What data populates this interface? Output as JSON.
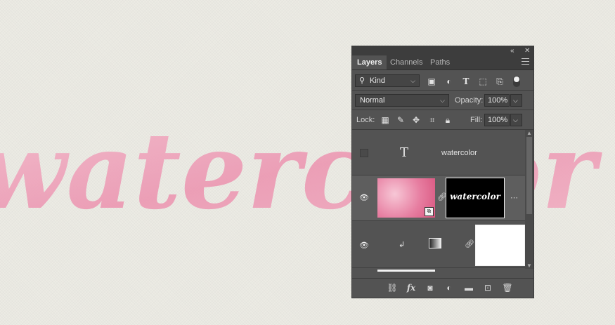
{
  "canvas": {
    "artwork_text": "watercolor",
    "text_color": "#ee9fb7"
  },
  "panel": {
    "tabs": [
      {
        "label": "Layers",
        "active": true
      },
      {
        "label": "Channels",
        "active": false
      },
      {
        "label": "Paths",
        "active": false
      }
    ],
    "filter": {
      "label": "Kind"
    },
    "blend_mode": "Normal",
    "opacity_label": "Opacity:",
    "opacity_value": "100%",
    "lock_label": "Lock:",
    "fill_label": "Fill:",
    "fill_value": "100%",
    "layers": [
      {
        "name": "watercolor",
        "type": "text",
        "visible": false
      },
      {
        "name": "",
        "type": "smart-object-with-mask",
        "visible": true,
        "mask_text": "watercolor"
      },
      {
        "name": "",
        "type": "adjustment-with-mask",
        "visible": true
      }
    ]
  },
  "colors": {
    "panel_bg": "#535353",
    "accent_pink": "#e87aa0"
  }
}
